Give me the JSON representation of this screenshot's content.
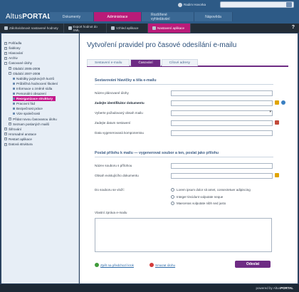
{
  "header": {
    "logo_plain": "Altus",
    "logo_bold": "PORTAL",
    "user_name": "Radim Hovorka",
    "nav": [
      "Dokumenty",
      "Administrace",
      "Rozšířené vyhledávání",
      "Nápověda"
    ],
    "nav_active_index": 1,
    "help_label": "?"
  },
  "actionbar": {
    "items": [
      "Záloha/obnovit nastavené hodnoty",
      "Export hodnot do XML",
      "Vzhled aplikace",
      "Nastavení aplikace"
    ],
    "active_index": 3
  },
  "sidebar": {
    "items": [
      {
        "label": "Pošťadla",
        "level": 0
      },
      {
        "label": "Šablony",
        "level": 0
      },
      {
        "label": "Hlasování",
        "level": 0
      },
      {
        "label": "Archiv",
        "level": 0
      },
      {
        "label": "Časované úlohy",
        "level": 0
      },
      {
        "label": "Období 2005-2006",
        "level": 1
      },
      {
        "label": "Období 2007-2008",
        "level": 1
      },
      {
        "label": "Nabídky jazykových kurzů",
        "level": 2
      },
      {
        "label": "Průběžná hodnocení školení",
        "level": 2
      },
      {
        "label": "Informace o změně sídla",
        "level": 2
      },
      {
        "label": "Personální obsazení",
        "level": 2
      },
      {
        "label": "Reorganizace struktury",
        "level": 2,
        "selected": true
      },
      {
        "label": "Pracovní řád",
        "level": 2
      },
      {
        "label": "Bezpečnost práce",
        "level": 2
      },
      {
        "label": "Vize společnosti",
        "level": 2
      },
      {
        "label": "Přidat novou časovanou úlohu",
        "level": 1
      },
      {
        "label": "Seznam poslaných mailů",
        "level": 1
      },
      {
        "label": "Šifrování",
        "level": 0
      },
      {
        "label": "Hromadné anotace",
        "level": 0
      },
      {
        "label": "Restart aplikace",
        "level": 0
      },
      {
        "label": "Datová struktura",
        "level": 0
      }
    ]
  },
  "main": {
    "title": "Vytvoření pravidel pro časové odesílání e-mailu",
    "tabs": [
      "Sestavení e-mailu",
      "Časování",
      "Cílové adresy"
    ],
    "active_tab_index": 1,
    "section1_title": "Sestavování hlavičky a těla e-mailu",
    "fields1": [
      {
        "label": "Název plánované úlohy",
        "type": "text",
        "bold": false
      },
      {
        "label": "Zadejte identifikátor dokumentu",
        "type": "text",
        "bold": true
      },
      {
        "label": "Vyberte požadovaný obsah mailu",
        "type": "select",
        "bold": false
      },
      {
        "label": "Zadejte datum sestavení",
        "type": "text",
        "bold": false
      },
      {
        "label": "Data vygenerovaná komponentou",
        "type": "text",
        "bold": false
      }
    ],
    "section2_title": "Poslat přílohu k mailu  —  vygenerovat soubor a ten, poslat jako přílohu",
    "fields2": [
      {
        "label": "Název souboru s přílohou"
      },
      {
        "label": "Obsah existujícího dokumentu"
      }
    ],
    "radio_label": "Do souboru se vloží:",
    "radios": [
      "Lorem ipsum dolor sit amet, consectetuer adipiscing",
      "Integer tincidunt vulputate neque",
      "Maecenas vulputate nibh sed justo"
    ],
    "textarea_label": "Vlastní zpráva e-mailu",
    "prev_link": "Zpět na předchozí krok",
    "delete_link": "Smazat úlohu",
    "send_button": "Odeslat"
  },
  "footer": {
    "powered_by": "powered by",
    "brand_plain": "Altus",
    "brand_bold": "PORTAL"
  },
  "colors": {
    "accent": "#6e2b84",
    "nav_active": "#b91b78",
    "header": "#2d5a86"
  }
}
